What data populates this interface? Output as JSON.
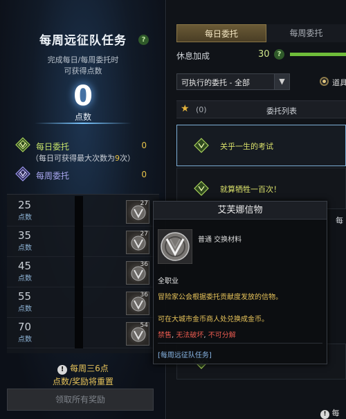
{
  "left_panel": {
    "title": "每周远征队任务",
    "subtitle_line1": "完成每日/每周委托时",
    "subtitle_line2": "可获得点数",
    "points_value": "0",
    "points_unit": "点数",
    "daily": {
      "label": "每日委托",
      "value": "0"
    },
    "daily_note_prefix": "（每日可获得最大次数为",
    "daily_note_count": "9",
    "daily_note_suffix": "次）",
    "weekly": {
      "label": "每周委托",
      "value": "0"
    },
    "tiers": [
      {
        "points": "25",
        "unit": "点数",
        "reward_count": "27"
      },
      {
        "points": "35",
        "unit": "点数",
        "reward_count": "27"
      },
      {
        "points": "45",
        "unit": "点数",
        "reward_count": "36"
      },
      {
        "points": "55",
        "unit": "点数",
        "reward_count": "36"
      },
      {
        "points": "70",
        "unit": "点数",
        "reward_count": "54"
      }
    ],
    "reset_notice_line1": "每周三6点",
    "reset_notice_line2": "点数/奖励将重置",
    "claim_all_button": "领取所有奖励"
  },
  "right_panel": {
    "tabs": [
      {
        "label": "每日委托",
        "active": true
      },
      {
        "label": "每周委托",
        "active": false
      }
    ],
    "rest_bonus_label": "休息加成",
    "rest_bonus_value": "30",
    "filter_value": "可执行的委托 - 全部",
    "radio_label": "道具",
    "list_header": {
      "count": "(0)",
      "title": "委托列表"
    },
    "quests": [
      {
        "title": "关乎一生的考试"
      },
      {
        "title": "就算牺牲一百次！"
      }
    ],
    "edge_labels": [
      "每"
    ],
    "bottom_notice": "每"
  },
  "tooltip": {
    "title": "艾芙娜信物",
    "grade": "普通 交换材料",
    "class": "全职业",
    "description": "冒险家公会根据委托贡献度发放的信物。",
    "exchange": "可在大城市金币商人处兑换成金币。",
    "restrict_1": "禁售",
    "restrict_2": "无法破坏",
    "restrict_3": "不可分解",
    "source": "[每周远征队任务]"
  },
  "colors": {
    "accent_gold": "#e8c45a",
    "daily_green": "#c6e36a",
    "weekly_purple": "#a9a7f0",
    "warning_red": "#e85a4f",
    "rest_bar_green": "#6fbd3a"
  }
}
